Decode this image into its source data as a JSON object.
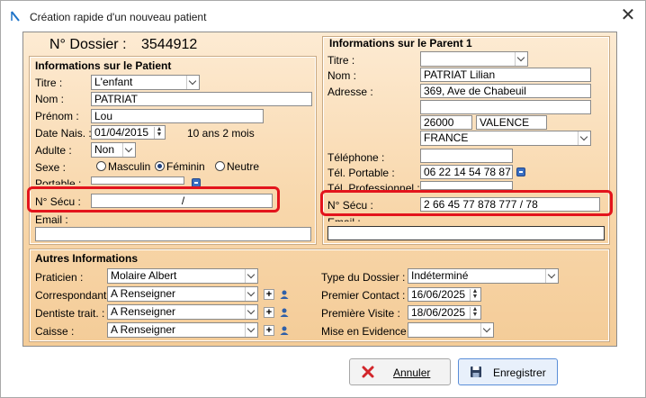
{
  "window": {
    "title": "Création rapide d'un nouveau patient",
    "close": "✕"
  },
  "dossier": {
    "label": "N° Dossier :",
    "number": "3544912"
  },
  "patient": {
    "section_title": "Informations sur le Patient",
    "titre_label": "Titre :",
    "titre_value": "L'enfant",
    "nom_label": "Nom :",
    "nom_value": "PATRIAT",
    "prenom_label": "Prénom :",
    "prenom_value": "Lou",
    "date_label": "Date Nais. :",
    "date_value": "01/04/2015",
    "age": "10 ans 2 mois",
    "adulte_label": "Adulte :",
    "adulte_value": "Non",
    "sexe_label": "Sexe :",
    "sexe_options": [
      "Masculin",
      "Féminin",
      "Neutre"
    ],
    "sexe_selected": "Féminin",
    "portable_label": "Portable :",
    "secu_label": "N° Sécu :",
    "secu_value": "/",
    "email_label": "Email :"
  },
  "parent": {
    "section_title": "Informations sur le Parent 1",
    "titre_label": "Titre :",
    "nom_label": "Nom :",
    "nom_value": "PATRIAT Lilian",
    "adresse_label": "Adresse :",
    "adresse_line1": "369, Ave de Chabeuil",
    "cp": "26000",
    "ville": "VALENCE",
    "pays": "FRANCE",
    "telephone_label": "Téléphone :",
    "portable_label": "Tél. Portable :",
    "portable_value": "06 22 14 54 78 87",
    "pro_label": "Tél. Professionnel :",
    "secu_label": "N° Sécu :",
    "secu_value": "2 66 45 77 878 777 / 78",
    "email_label": "Email :"
  },
  "autres": {
    "section_title": "Autres Informations",
    "praticien_label": "Praticien :",
    "praticien_value": "Molaire Albert",
    "correspondant_label": "Correspondant :",
    "correspondant_value": "A Renseigner",
    "dentiste_label": "Dentiste trait. :",
    "dentiste_value": "A Renseigner",
    "caisse_label": "Caisse :",
    "caisse_value": "A Renseigner",
    "type_label": "Type du Dossier :",
    "type_value": "Indéterminé",
    "premier_contact_label": "Premier Contact :",
    "premier_contact_value": "16/06/2025",
    "premiere_visite_label": "Première Visite :",
    "premiere_visite_value": "18/06/2025",
    "evidence_label": "Mise en Evidence :",
    "plus": "+"
  },
  "buttons": {
    "annuler": "Annuler",
    "enregistrer": "Enregistrer"
  },
  "colors": {
    "highlight": "#e3141c",
    "panel": "#f8d7ab",
    "accent": "#3a6fc2"
  }
}
